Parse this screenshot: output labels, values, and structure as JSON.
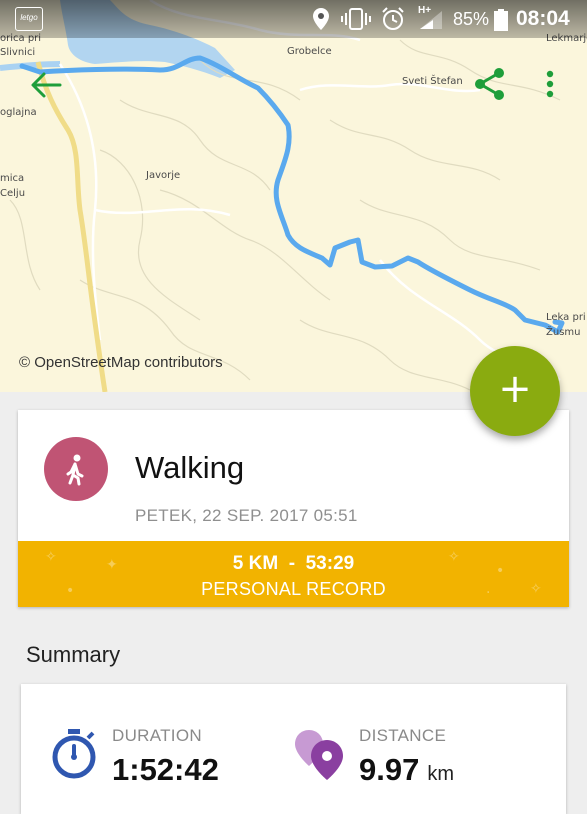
{
  "status_bar": {
    "logo": "letgo",
    "battery": "85%",
    "network": "H+",
    "time": "08:04"
  },
  "toolbar": {
    "back_icon": "arrow-left-icon",
    "share_icon": "share-icon",
    "more_icon": "more-vert-icon",
    "icon_color": "#1e9e3a"
  },
  "map": {
    "attribution": "© OpenStreetMap contributors",
    "route_color": "#5aa9ee",
    "places": {
      "p1": "orica pri",
      "p2": "Slivnici",
      "p3": "Grobelce",
      "p4": "Sveti Štefan",
      "p5": "Lekmarje",
      "p6": "oglajna",
      "p7": "Javorje",
      "p8": "mica",
      "p9": "Celju",
      "p10": "Leka pri",
      "p11": "Žusmu"
    }
  },
  "fab": {
    "label": "+",
    "icon": "add-icon",
    "color": "#8aab10"
  },
  "workout": {
    "activity": "Walking",
    "activity_icon": "walking-icon",
    "avatar_color": "#c05474",
    "date": "PETEK, 22 SEP. 2017 05:51",
    "record": {
      "value": "5 KM  -  53:29",
      "label": "PERSONAL RECORD",
      "color": "#f2b300"
    }
  },
  "summary": {
    "heading": "Summary",
    "duration": {
      "label": "DURATION",
      "value": "1:52:42",
      "icon": "stopwatch-icon"
    },
    "distance": {
      "label": "DISTANCE",
      "value": "9.97",
      "unit": "km",
      "icon": "location-pins-icon"
    }
  }
}
